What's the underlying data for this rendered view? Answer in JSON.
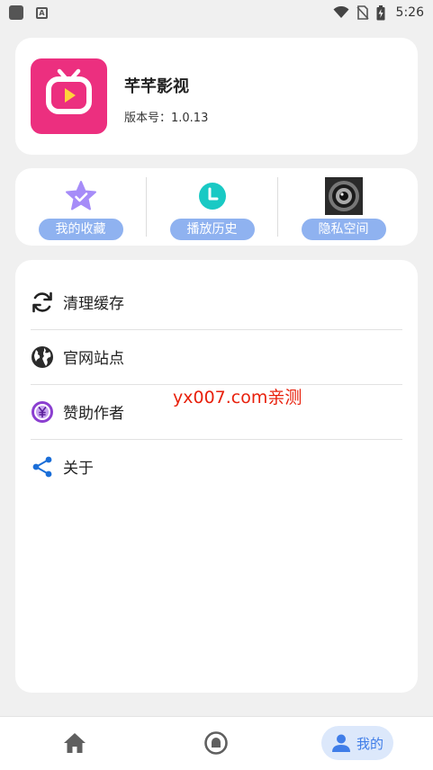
{
  "status_bar": {
    "time": "5:26"
  },
  "app": {
    "name": "芊芊影视",
    "version_label": "版本号：1.0.13"
  },
  "quick_actions": [
    {
      "label": "我的收藏",
      "icon": "star-check-icon",
      "color": "#9b87f5"
    },
    {
      "label": "播放历史",
      "icon": "clock-icon",
      "color": "#1fc8c8"
    },
    {
      "label": "隐私空间",
      "icon": "lens-icon",
      "color": "#333333"
    }
  ],
  "menu": [
    {
      "label": "清理缓存",
      "icon": "refresh-icon"
    },
    {
      "label": "官网站点",
      "icon": "globe-icon"
    },
    {
      "label": "赞助作者",
      "icon": "yuan-coin-icon"
    },
    {
      "label": "关于",
      "icon": "share-icon"
    }
  ],
  "watermark": "yx007.com亲测",
  "bottom_nav": {
    "items": [
      {
        "name": "home",
        "icon": "home-icon"
      },
      {
        "name": "discover",
        "icon": "video-circle-icon"
      },
      {
        "name": "mine",
        "icon": "person-icon",
        "label": "我的",
        "active": true
      }
    ]
  },
  "colors": {
    "accent": "#3f7de8",
    "pill": "#8fb2f0",
    "app_icon_bg": "#ec2f7f",
    "watermark": "#e8200c"
  }
}
